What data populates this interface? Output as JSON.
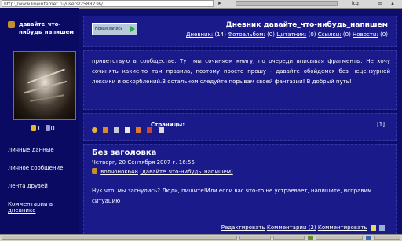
{
  "browser": {
    "url": "http://www.liveinternet.ru/users/2588236/",
    "icq_label": "icq"
  },
  "sidebar": {
    "diary_link": "давайте_что-нибудь_напишем",
    "stats_a": "1",
    "stats_b": "0",
    "menu": [
      {
        "label": "Личные данные"
      },
      {
        "label": "Личное сообщение"
      },
      {
        "label": "Лента друзей"
      },
      {
        "label_line1": "Комментарии в",
        "label_line2": "дневнике"
      }
    ]
  },
  "header": {
    "new_post_button": "Новая запись",
    "diary_title": "Дневник давайте_что-нибудь_напишем",
    "counts": {
      "diary_label": "Дневник:",
      "diary_count": "(14)",
      "photo_label": "Фотоальбом:",
      "photo_count": "(0)",
      "quote_label": "Цитатник:",
      "quote_count": "(0)",
      "links_label": "Ссылки:",
      "links_count": "(0)",
      "news_label": "Новости:",
      "news_count": "(0)"
    }
  },
  "welcome_text": "приветствую в сообществе. Тут мы сочиняем книгу, по очереди вписывая фрагменты. Не хочу сочинять какие-то там правила, поэтому просто прошу - давайте обойдемся без нецензурной лексики и оскорблений.В остальном следуйте порывам своей фантазии! В добрый путь!",
  "pages": {
    "label": "Страницы:",
    "count": "[1]"
  },
  "post": {
    "title": "Без заголовка",
    "date": "Четверг, 20 Сентября 2007 г. 16:55",
    "author": "волчонок648",
    "community": "(давайте_что-нибудь_напишем)",
    "body": "Нук что, мы загнулись? Люди, пишите!Или если вас что-то не устраевает, напишите, исправим ситуацию",
    "edit_link": "Редактировать",
    "comments_link": "Комментарии (2)",
    "comment_link": "Комментировать"
  },
  "colors": {
    "page_bg": "#0d0d6e",
    "panel_bg": "#1a1a8a",
    "sidebar_bg": "#0a0a62",
    "text": "#ffffff"
  }
}
